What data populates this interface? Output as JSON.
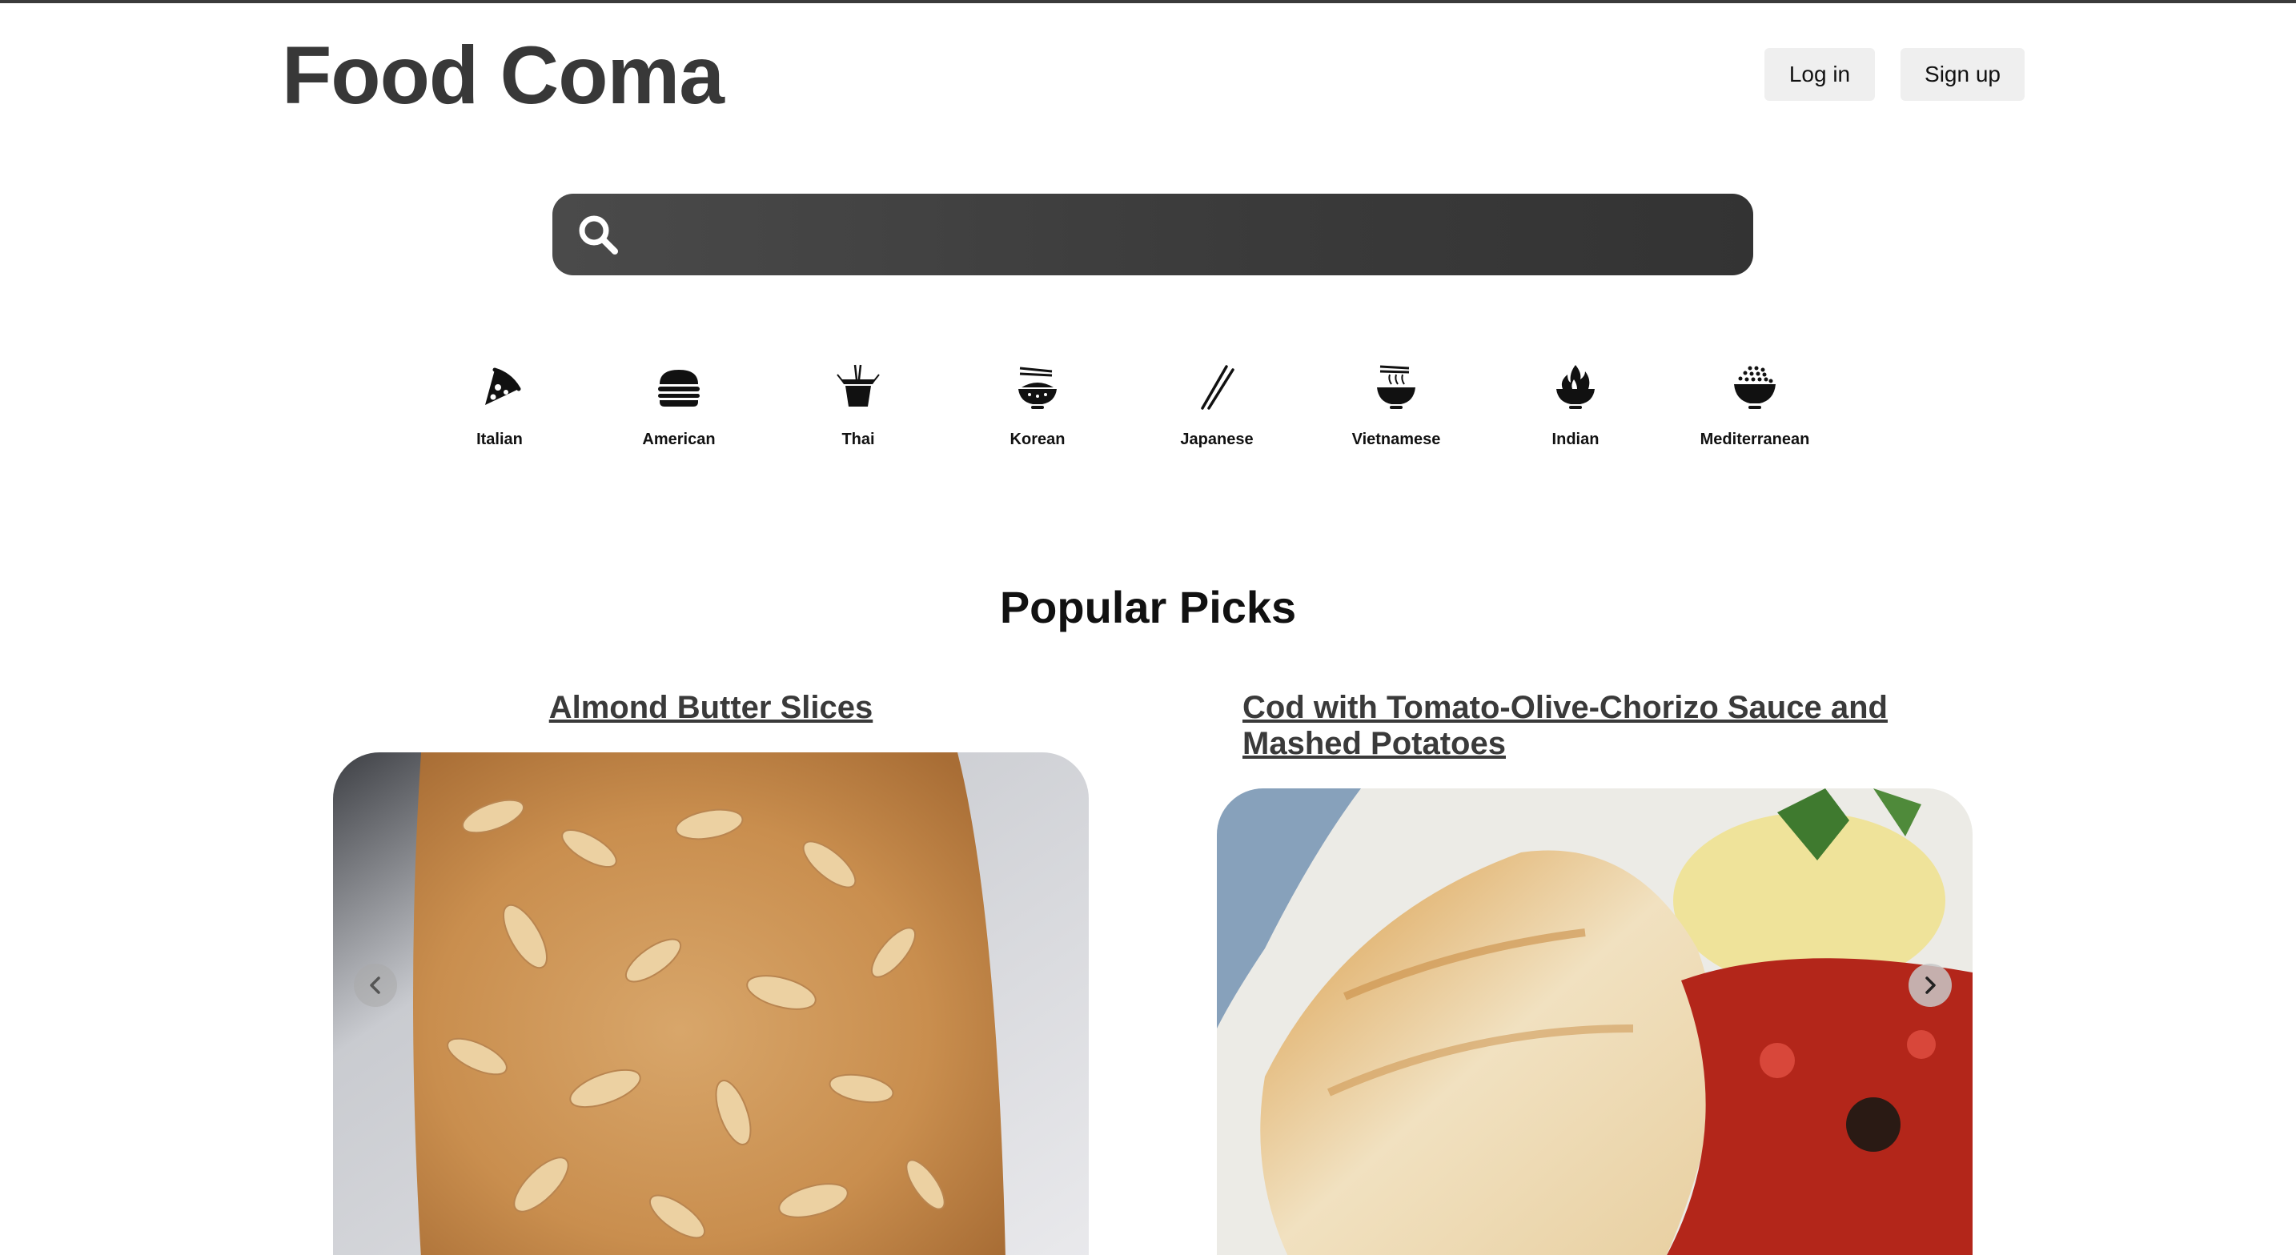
{
  "header": {
    "logo": "Food Coma",
    "login_label": "Log in",
    "signup_label": "Sign up"
  },
  "search": {
    "placeholder": "",
    "value": "",
    "icon": "search-icon"
  },
  "cuisines": [
    {
      "label": "Italian",
      "icon": "pizza-slice-icon"
    },
    {
      "label": "American",
      "icon": "burger-icon"
    },
    {
      "label": "Thai",
      "icon": "takeout-box-icon"
    },
    {
      "label": "Korean",
      "icon": "rice-bowl-chopsticks-icon"
    },
    {
      "label": "Japanese",
      "icon": "chopsticks-icon"
    },
    {
      "label": "Vietnamese",
      "icon": "noodle-bowl-icon"
    },
    {
      "label": "Indian",
      "icon": "flame-bowl-icon"
    },
    {
      "label": "Mediterranean",
      "icon": "grain-bowl-icon"
    }
  ],
  "popular": {
    "title": "Popular Picks",
    "cards": [
      {
        "title": "Almond Butter Slices",
        "image": "almond-butter-slices-photo"
      },
      {
        "title": "Cod with Tomato-Olive-Chorizo Sauce and Mashed Potatoes",
        "image": "cod-tomato-olive-chorizo-photo"
      }
    ],
    "prev_icon": "chevron-left-icon",
    "next_icon": "chevron-right-icon"
  },
  "colors": {
    "logo": "#383838",
    "search_bar": "#3a3a3a",
    "button_bg": "#efefef",
    "top_border": "#3b3b3b"
  }
}
